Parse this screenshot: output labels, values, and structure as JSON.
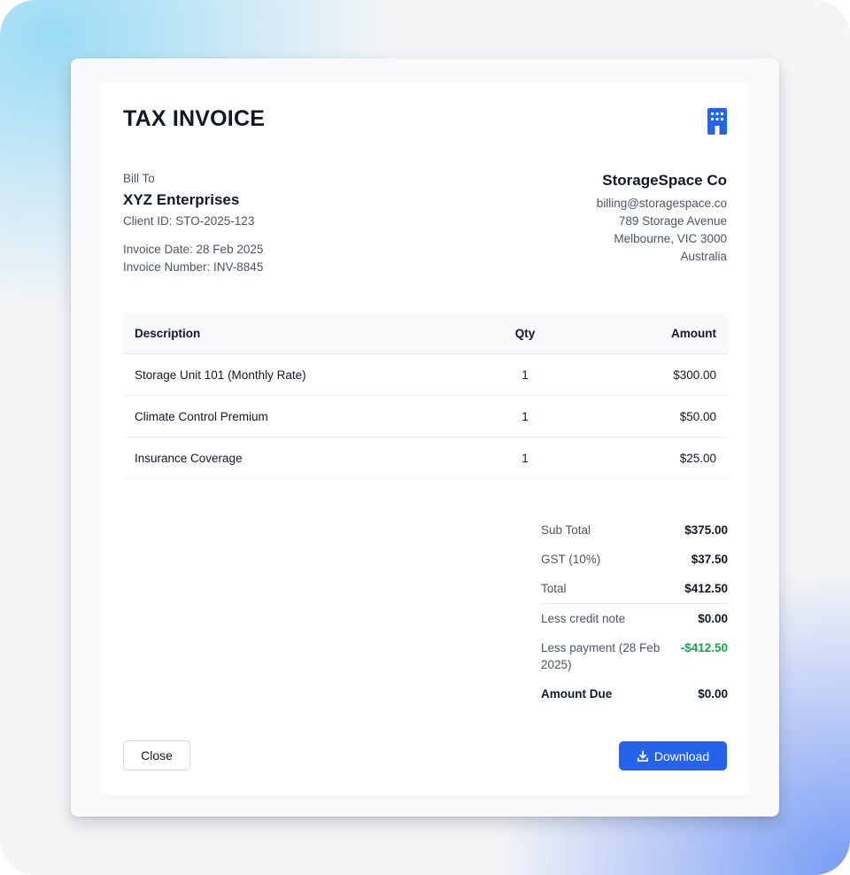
{
  "colors": {
    "accent": "#2563eb",
    "payment_green": "#16a34a",
    "text_primary": "#111827",
    "text_muted": "#4b5563"
  },
  "invoice": {
    "title": "TAX INVOICE",
    "logo_icon": "building-icon"
  },
  "bill_to": {
    "label": "Bill To",
    "client_name": "XYZ Enterprises",
    "client_id": "Client ID: STO-2025-123",
    "invoice_date": "Invoice Date: 28 Feb 2025",
    "invoice_number": "Invoice Number: INV-8845"
  },
  "company": {
    "name": "StorageSpace Co",
    "email": "billing@storagespace.co",
    "address_line1": "789 Storage Avenue",
    "address_line2": "Melbourne, VIC 3000",
    "country": "Australia"
  },
  "items_table": {
    "headers": {
      "description": "Description",
      "qty": "Qty",
      "amount": "Amount"
    },
    "rows": [
      {
        "description": "Storage Unit 101 (Monthly Rate)",
        "qty": "1",
        "amount": "$300.00"
      },
      {
        "description": "Climate Control Premium",
        "qty": "1",
        "amount": "$50.00"
      },
      {
        "description": "Insurance Coverage",
        "qty": "1",
        "amount": "$25.00"
      }
    ]
  },
  "totals": {
    "subtotal_label": "Sub Total",
    "subtotal_value": "$375.00",
    "gst_label": "GST (10%)",
    "gst_value": "$37.50",
    "total_label": "Total",
    "total_value": "$412.50",
    "credit_label": "Less credit note",
    "credit_value": "$0.00",
    "payment_label": "Less payment (28 Feb 2025)",
    "payment_value": "-$412.50",
    "due_label": "Amount Due",
    "due_value": "$0.00"
  },
  "actions": {
    "close_label": "Close",
    "download_label": "Download",
    "download_icon": "download-icon"
  }
}
